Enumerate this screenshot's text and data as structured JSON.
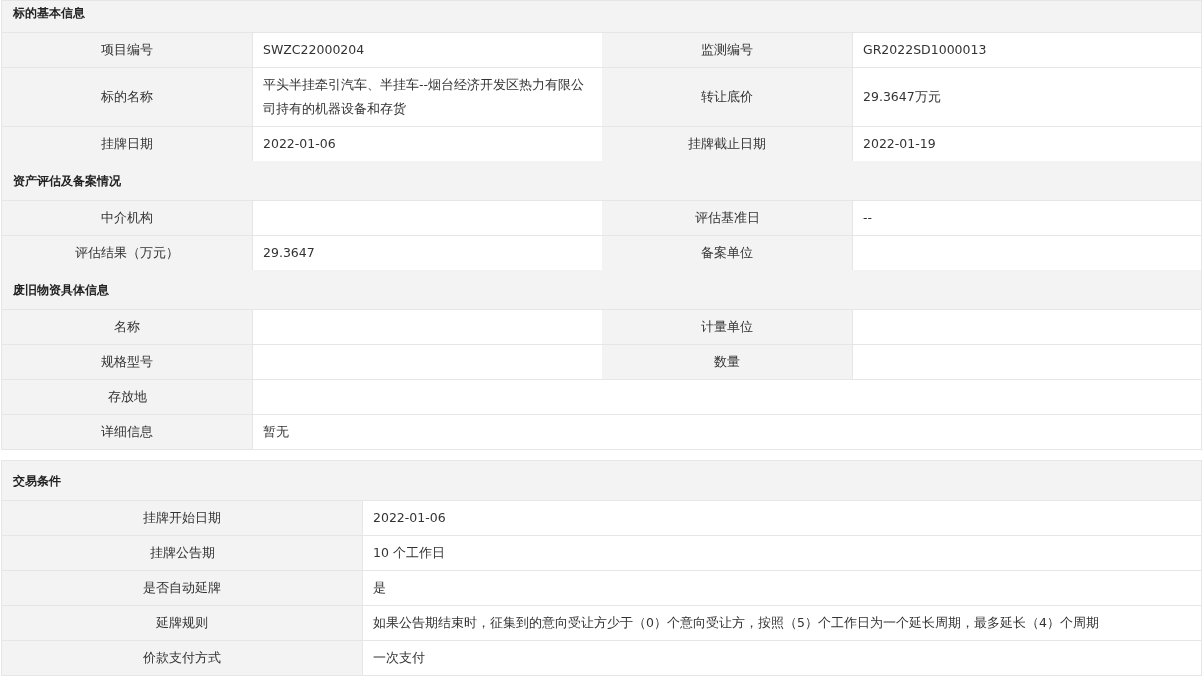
{
  "blocks": [
    {
      "sections": [
        {
          "title": "标的基本信息",
          "rows": [
            {
              "cells": [
                {
                  "label": "项目编号",
                  "value": "SWZC22000204"
                },
                {
                  "label": "监测编号",
                  "value": "GR2022SD1000013"
                }
              ]
            },
            {
              "cells": [
                {
                  "label": "标的名称",
                  "value": "平头半挂牵引汽车、半挂车--烟台经济开发区热力有限公司持有的机器设备和存货"
                },
                {
                  "label": "转让底价",
                  "value": "29.3647万元"
                }
              ]
            },
            {
              "cells": [
                {
                  "label": "挂牌日期",
                  "value": "2022-01-06"
                },
                {
                  "label": "挂牌截止日期",
                  "value": "2022-01-19"
                }
              ]
            }
          ]
        },
        {
          "title": "资产评估及备案情况",
          "rows": [
            {
              "cells": [
                {
                  "label": "中介机构"
                },
                {
                  "label": "评估基准日",
                  "value": "--"
                }
              ]
            },
            {
              "cells": [
                {
                  "label": "评估结果（万元）",
                  "value": "29.3647"
                },
                {
                  "label": "备案单位"
                }
              ]
            }
          ]
        },
        {
          "title": "废旧物资具体信息",
          "rows": [
            {
              "cells": [
                {
                  "label": "名称"
                },
                {
                  "label": "计量单位"
                }
              ]
            },
            {
              "cells": [
                {
                  "label": "规格型号"
                },
                {
                  "label": "数量"
                }
              ]
            },
            {
              "cells": [
                {
                  "label": "存放地"
                }
              ]
            },
            {
              "cells": [
                {
                  "label": "详细信息",
                  "value": "暂无"
                }
              ]
            }
          ]
        }
      ]
    },
    {
      "sections": [
        {
          "title": "交易条件",
          "rows": [
            {
              "cells": [
                {
                  "label": "挂牌开始日期",
                  "value": "2022-01-06"
                }
              ]
            },
            {
              "cells": [
                {
                  "label": "挂牌公告期",
                  "value": "10 个工作日"
                }
              ]
            },
            {
              "cells": [
                {
                  "label": "是否自动延牌",
                  "value": "是"
                }
              ]
            },
            {
              "cells": [
                {
                  "label": "延牌规则",
                  "value": "如果公告期结束时，征集到的意向受让方少于（0）个意向受让方，按照（5）个工作日为一个延长周期，最多延长（4）个周期"
                }
              ]
            },
            {
              "cells": [
                {
                  "label": "价款支付方式",
                  "value": "一次支付"
                }
              ]
            }
          ]
        }
      ]
    }
  ]
}
